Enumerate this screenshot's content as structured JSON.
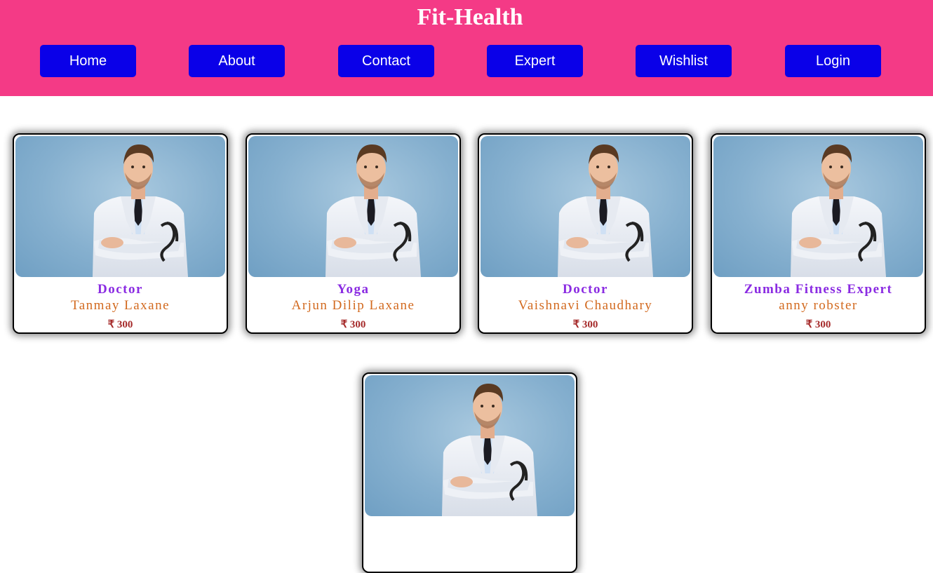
{
  "header": {
    "title": "Fit-Health",
    "background": "#f43a86",
    "nav": [
      {
        "label": "Home"
      },
      {
        "label": "About"
      },
      {
        "label": "Contact"
      },
      {
        "label": "Expert"
      },
      {
        "label": "Wishlist"
      },
      {
        "label": "Login"
      }
    ],
    "nav_color": "#0a00e8"
  },
  "experts": [
    {
      "role": "Doctor",
      "name": "Tanmay Laxane",
      "price": "₹ 300",
      "photo_icon": "doctor-photo"
    },
    {
      "role": "Yoga",
      "name": "Arjun Dilip Laxane",
      "price": "₹ 300",
      "photo_icon": "doctor-photo"
    },
    {
      "role": "Doctor",
      "name": "Vaishnavi Chaudhary",
      "price": "₹ 300",
      "photo_icon": "doctor-photo"
    },
    {
      "role": "Zumba Fitness Expert",
      "name": "anny robster",
      "price": "₹ 300",
      "photo_icon": "doctor-photo"
    },
    {
      "role": "",
      "name": "",
      "price": "",
      "photo_icon": "doctor-photo"
    }
  ],
  "colors": {
    "role": "#8a2be2",
    "name": "#d2691e",
    "price": "#a52a2a"
  }
}
